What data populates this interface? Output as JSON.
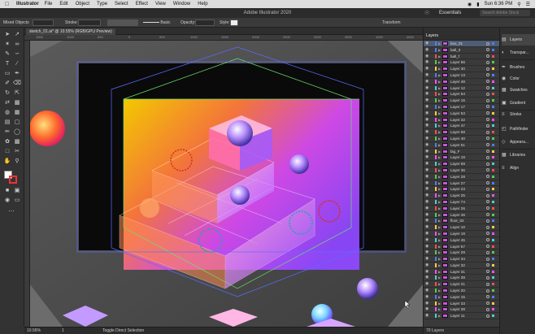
{
  "menubar": {
    "app": "Illustrator",
    "items": [
      "File",
      "Edit",
      "Object",
      "Type",
      "Select",
      "Effect",
      "View",
      "Window",
      "Help"
    ],
    "clock": "Sun 6:36 PM"
  },
  "titlebar": {
    "title": "Adobe Illustrator 2020",
    "workspace": "Essentials",
    "search_placeholder": "Search Adobe Stock"
  },
  "controlbar": {
    "selection": "Mixed Objects",
    "stroke_label": "Stroke:",
    "brush": "Basic",
    "opacity_label": "Opacity:",
    "style_label": "Style:",
    "transform_label": "Transform"
  },
  "document": {
    "tab_title": "sketch_01.ai* @ 10.55% (RGB/GPU Preview)",
    "ruler_ticks": [
      "1500",
      "1000",
      "500",
      "0",
      "500",
      "1000",
      "1500",
      "2000",
      "2500",
      "3000",
      "3500",
      "4000",
      "4500"
    ]
  },
  "statusbar": {
    "zoom": "10.56%",
    "artboard": "1",
    "tool_hint": "Toggle Direct Selection"
  },
  "layers_panel": {
    "title": "Layers",
    "footer": "70 Layers",
    "rows": [
      {
        "name": "box_01",
        "color": "#4f7cff",
        "selected": true
      },
      {
        "name": "ball_0",
        "color": "#4f7cff"
      },
      {
        "name": "ball_f",
        "color": "#ff4f4f"
      },
      {
        "name": "Layer 56",
        "color": "#4fd04f"
      },
      {
        "name": "Layer 30",
        "color": "#ffcf3f"
      },
      {
        "name": "Layer 13",
        "color": "#4f7cff"
      },
      {
        "name": "Layer 48",
        "color": "#ff4fff"
      },
      {
        "name": "Layer 12",
        "color": "#4fd0d0"
      },
      {
        "name": "Layer 54",
        "color": "#ff4f4f"
      },
      {
        "name": "Layer 16",
        "color": "#4fd04f"
      },
      {
        "name": "Layer 17",
        "color": "#4f7cff"
      },
      {
        "name": "Layer 53",
        "color": "#ffcf3f"
      },
      {
        "name": "Layer 22",
        "color": "#ff4fff"
      },
      {
        "name": "Layer 47",
        "color": "#4fd0d0"
      },
      {
        "name": "Layer 58",
        "color": "#ff4f4f"
      },
      {
        "name": "Layer 40",
        "color": "#4fd04f"
      },
      {
        "name": "Layer 51",
        "color": "#4f7cff"
      },
      {
        "name": "big_F",
        "color": "#ffcf3f"
      },
      {
        "name": "Layer 19",
        "color": "#ff4fff"
      },
      {
        "name": "Layer 59",
        "color": "#4fd0d0"
      },
      {
        "name": "Layer 36",
        "color": "#ff4f4f"
      },
      {
        "name": "Layer 28",
        "color": "#4fd04f"
      },
      {
        "name": "Layer 27",
        "color": "#4f7cff"
      },
      {
        "name": "Layer 23",
        "color": "#ffcf3f"
      },
      {
        "name": "Layer 25",
        "color": "#ff4fff"
      },
      {
        "name": "Layer 74",
        "color": "#4fd0d0"
      },
      {
        "name": "Layer 26",
        "color": "#ff4f4f"
      },
      {
        "name": "Layer 46",
        "color": "#4fd04f"
      },
      {
        "name": "floor_02",
        "color": "#4f7cff"
      },
      {
        "name": "Layer 10",
        "color": "#ffcf3f"
      },
      {
        "name": "Layer 18",
        "color": "#ff4fff"
      },
      {
        "name": "Layer 45",
        "color": "#4fd0d0"
      },
      {
        "name": "Layer 57",
        "color": "#ff4f4f"
      },
      {
        "name": "Layer 29",
        "color": "#4fd04f"
      },
      {
        "name": "Layer 34",
        "color": "#4f7cff"
      },
      {
        "name": "Layer 32",
        "color": "#ffcf3f"
      },
      {
        "name": "Layer 31",
        "color": "#ff4fff"
      },
      {
        "name": "Layer 39",
        "color": "#4fd0d0"
      },
      {
        "name": "Layer 21",
        "color": "#ff4f4f"
      },
      {
        "name": "Layer 20",
        "color": "#4fd04f"
      },
      {
        "name": "Layer 15",
        "color": "#4f7cff"
      },
      {
        "name": "Layer 33",
        "color": "#ffcf3f"
      },
      {
        "name": "Layer 38",
        "color": "#ff4fff"
      },
      {
        "name": "Layer 11",
        "color": "#4fd0d0"
      }
    ]
  },
  "dock": {
    "items": [
      {
        "label": "Layers",
        "icon": "layers-icon"
      },
      {
        "label": "Transpar...",
        "icon": "transparency-icon"
      },
      {
        "label": "Brushes",
        "icon": "brushes-icon"
      },
      {
        "label": "Color",
        "icon": "color-icon"
      },
      {
        "label": "Swatches",
        "icon": "swatches-icon"
      },
      {
        "label": "Gradient",
        "icon": "gradient-icon"
      },
      {
        "label": "Stroke",
        "icon": "stroke-icon"
      },
      {
        "label": "Pathfinder",
        "icon": "pathfinder-icon"
      },
      {
        "label": "Appeara...",
        "icon": "appearance-icon"
      },
      {
        "label": "Libraries",
        "icon": "libraries-icon"
      },
      {
        "label": "Align",
        "icon": "align-icon"
      }
    ]
  }
}
